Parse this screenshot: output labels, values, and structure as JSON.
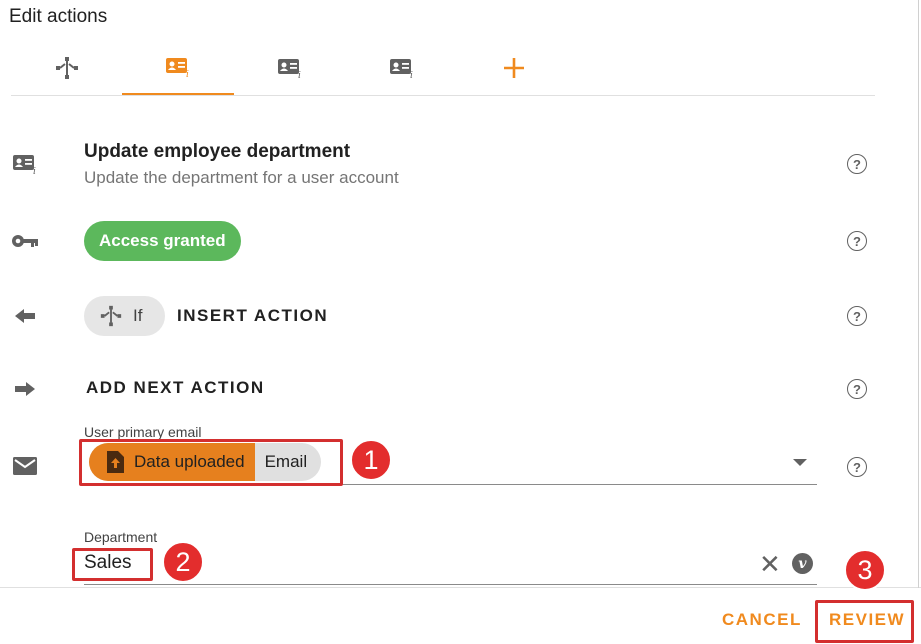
{
  "header": {
    "title": "Edit actions"
  },
  "tabs": [
    {
      "icon": "flow-icon",
      "active": false
    },
    {
      "icon": "id-card-icon",
      "active": true
    },
    {
      "icon": "id-card-icon",
      "active": false
    },
    {
      "icon": "id-card-icon",
      "active": false
    },
    {
      "icon": "plus-icon",
      "active": false
    }
  ],
  "action": {
    "title": "Update employee department",
    "subtitle": "Update the department for a user account"
  },
  "access": {
    "label": "Access granted"
  },
  "insert": {
    "chip_label": "If",
    "label": "INSERT ACTION"
  },
  "add_next": {
    "label": "ADD NEXT ACTION"
  },
  "email_field": {
    "label": "User primary email",
    "chip_source": "Data uploaded",
    "chip_value": "Email"
  },
  "department_field": {
    "label": "Department",
    "value": "Sales",
    "variable_icon_label": "v"
  },
  "footer": {
    "cancel_label": "CANCEL",
    "review_label": "REVIEW"
  },
  "annotations": [
    "1",
    "2",
    "3"
  ],
  "colors": {
    "accent": "#f08a1e",
    "access_green": "#5cb85c",
    "chip_orange": "#e6801e",
    "highlight_red": "#d32f2f",
    "badge_red": "#e32d2d"
  }
}
